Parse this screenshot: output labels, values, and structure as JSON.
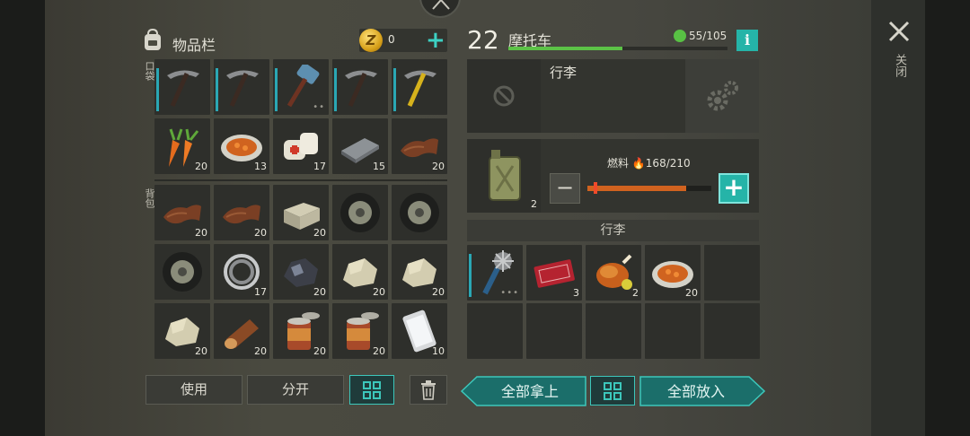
{
  "inventory": {
    "title": "物品栏",
    "coins": "0",
    "pocket_label": "口袋",
    "backpack_label": "背包",
    "pocket": [
      {
        "icon": "pickaxe-icon",
        "count": "",
        "durability": true
      },
      {
        "icon": "pickaxe-icon",
        "count": "",
        "durability": true
      },
      {
        "icon": "sledgehammer-icon",
        "count": "",
        "durability": true,
        "dots": "••"
      },
      {
        "icon": "pickaxe-icon",
        "count": "",
        "durability": true
      },
      {
        "icon": "pickaxe-yellow-icon",
        "count": "",
        "durability": true
      },
      {
        "icon": "carrot-icon",
        "count": "20"
      },
      {
        "icon": "stew-plate-icon",
        "count": "13"
      },
      {
        "icon": "bandage-icon",
        "count": "17"
      },
      {
        "icon": "metal-bar-icon",
        "count": "15"
      },
      {
        "icon": "leather-icon",
        "count": "20"
      }
    ],
    "backpack": [
      {
        "icon": "leather-icon",
        "count": "20"
      },
      {
        "icon": "leather-icon",
        "count": "20"
      },
      {
        "icon": "stone-block-icon",
        "count": "20"
      },
      {
        "icon": "tire-icon",
        "count": ""
      },
      {
        "icon": "tire-icon",
        "count": ""
      },
      {
        "icon": "tire-icon",
        "count": ""
      },
      {
        "icon": "bearing-icon",
        "count": "17"
      },
      {
        "icon": "coal-ore-icon",
        "count": "20"
      },
      {
        "icon": "stone-icon",
        "count": "20"
      },
      {
        "icon": "stone-icon",
        "count": "20"
      },
      {
        "icon": "stone-icon",
        "count": "20"
      },
      {
        "icon": "log-icon",
        "count": "20"
      },
      {
        "icon": "canned-food-icon",
        "count": "20"
      },
      {
        "icon": "canned-food-icon",
        "count": "20"
      },
      {
        "icon": "smartphone-icon",
        "count": "10"
      }
    ],
    "buttons": {
      "use": "使用",
      "split": "分开"
    }
  },
  "vehicle": {
    "level": "22",
    "name": "摩托车",
    "hp_text": "55/105",
    "hp_fraction": 0.52,
    "info_label": "i",
    "luggage_title": "行李",
    "jerrycan_count": "2",
    "fuel_label": "燃料",
    "fuel_text": "168/210",
    "fuel_fraction": 0.8,
    "section_label": "行李",
    "luggage_items": [
      {
        "icon": "spiked-club-icon",
        "count": "",
        "durability": true,
        "dots": "•••"
      },
      {
        "icon": "coupon-icon",
        "count": "3"
      },
      {
        "icon": "roast-chicken-icon",
        "count": "2"
      },
      {
        "icon": "stew-plate-icon",
        "count": "20"
      },
      {
        "icon": "",
        "count": ""
      },
      {
        "icon": "",
        "count": ""
      },
      {
        "icon": "",
        "count": ""
      },
      {
        "icon": "",
        "count": ""
      },
      {
        "icon": "",
        "count": ""
      },
      {
        "icon": "",
        "count": ""
      }
    ],
    "take_all": "全部拿上",
    "put_all": "全部放入"
  },
  "close_label": "关闭",
  "colors": {
    "accent": "#25b4a8",
    "hp": "#5cc247",
    "fuel": "#d0621f"
  }
}
